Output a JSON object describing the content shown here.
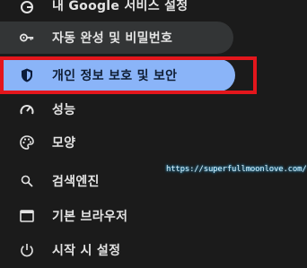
{
  "menu": {
    "items": [
      {
        "label": "내 Google 서비스 설정",
        "icon": "google-g-icon"
      },
      {
        "label": "자동 완성 및 비밀번호",
        "icon": "key-icon"
      },
      {
        "label": "개인 정보 보호 및 보안",
        "icon": "shield-icon",
        "active": true
      },
      {
        "label": "성능",
        "icon": "speedometer-icon"
      },
      {
        "label": "모양",
        "icon": "palette-icon"
      },
      {
        "label": "검색엔진",
        "icon": "search-icon"
      },
      {
        "label": "기본 브라우저",
        "icon": "browser-window-icon"
      },
      {
        "label": "시작 시 설정",
        "icon": "power-icon"
      }
    ]
  },
  "watermark": {
    "text": "https://superfullmoonlove.com/"
  },
  "colors": {
    "background": "#1b1b1b",
    "active_pill": "#8ab4f8",
    "hover_pill": "#333536",
    "highlight_border": "#e3161c",
    "text": "#e3e3e3"
  }
}
